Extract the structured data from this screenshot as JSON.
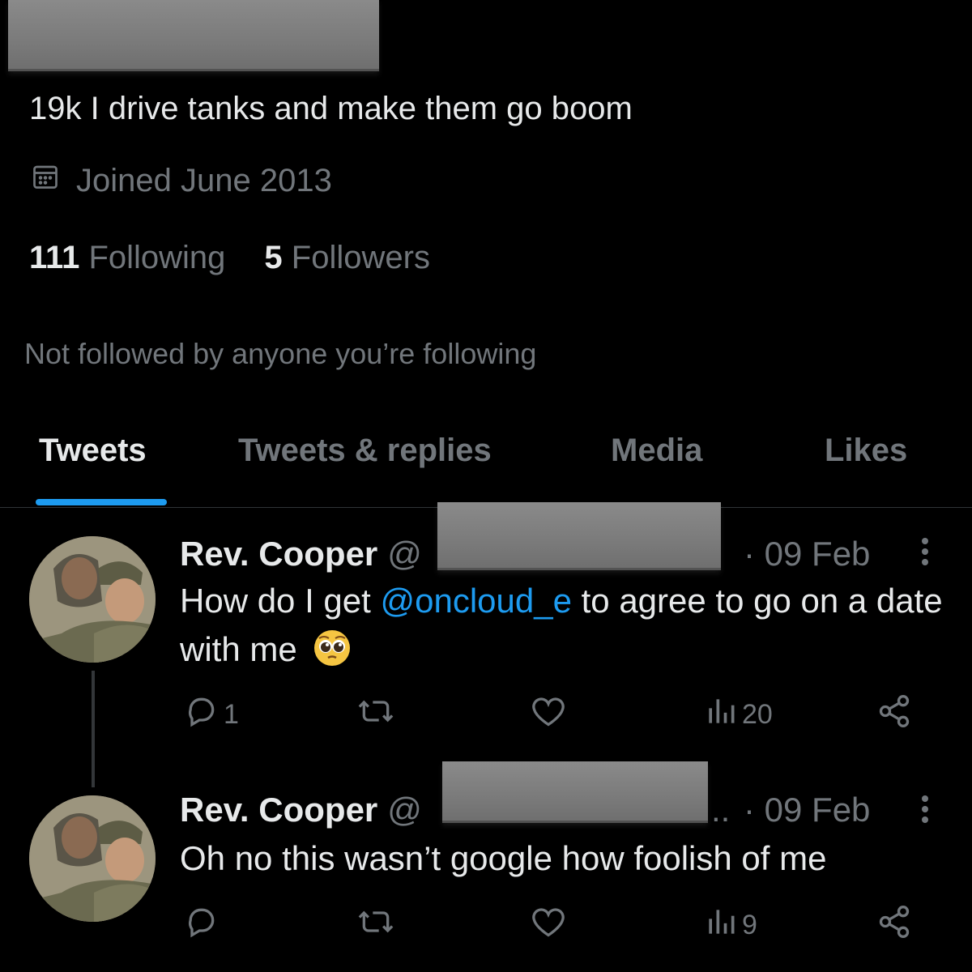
{
  "profile": {
    "bio": "19k I drive tanks and make them go boom",
    "joined": "Joined June 2013",
    "following_count": "111",
    "following_label": "Following",
    "followers_count": "5",
    "followers_label": "Followers",
    "not_followed": "Not followed by anyone you’re following"
  },
  "tabs": [
    {
      "label": "Tweets",
      "active": true
    },
    {
      "label": "Tweets & replies",
      "active": false
    },
    {
      "label": "Media",
      "active": false
    },
    {
      "label": "Likes",
      "active": false
    }
  ],
  "tweets": [
    {
      "name": "Rev. Cooper",
      "handle_prefix": "@",
      "date": "· 09 Feb",
      "text_before": "How do I get ",
      "mention": "@oncloud_e",
      "text_after": " to agree to go on a date with me",
      "emoji": "🥺",
      "replies": "1",
      "views": "20"
    },
    {
      "name": "Rev. Cooper",
      "handle_prefix": "@",
      "handle_suffix": "..",
      "date": "· 09 Feb",
      "text": "Oh no this wasn’t google how foolish of me",
      "replies": "",
      "views": "9"
    }
  ],
  "colors": {
    "background": "#000000",
    "text": "#e7e9ea",
    "secondary": "#71767b",
    "accent": "#1d9bf0"
  }
}
